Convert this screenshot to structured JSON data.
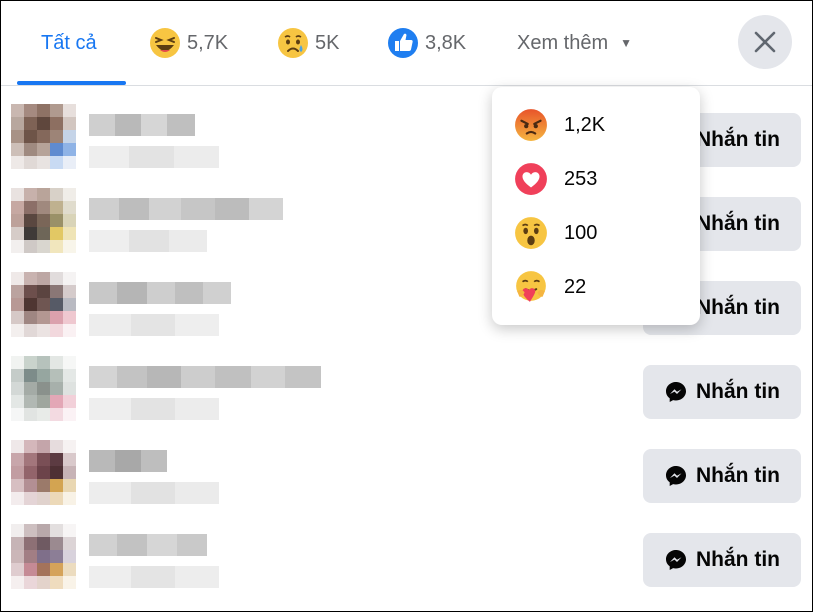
{
  "tabs": {
    "all_label": "Tất cả",
    "haha_count": "5,7K",
    "sad_count": "5K",
    "like_count": "3,8K",
    "more_label": "Xem thêm",
    "more_caret": "▼"
  },
  "dropdown": {
    "items": [
      {
        "icon": "angry-emoji-icon",
        "count": "1,2K"
      },
      {
        "icon": "love-heart-icon",
        "count": "253"
      },
      {
        "icon": "wow-emoji-icon",
        "count": "100"
      },
      {
        "icon": "care-emoji-icon",
        "count": "22"
      }
    ]
  },
  "list": {
    "message_label": "Nhắn tin"
  },
  "colors": {
    "accent": "#1877f2",
    "button_bg": "#e4e6eb",
    "text": "#050505",
    "muted": "#65676b"
  }
}
